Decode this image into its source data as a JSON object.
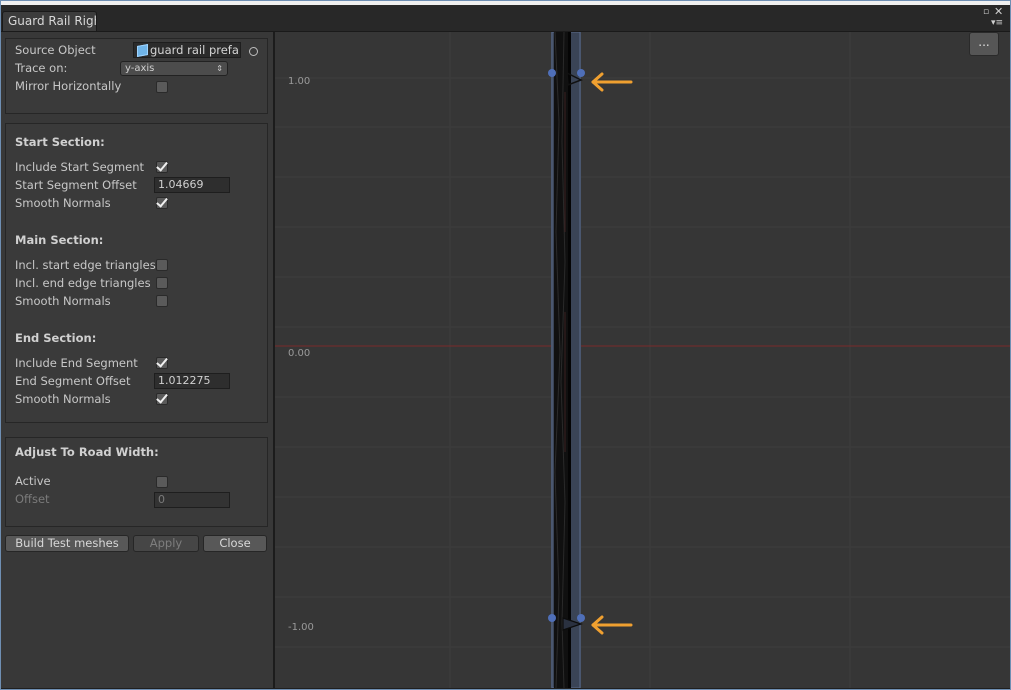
{
  "window": {
    "tab_title": "Guard Rail Righ"
  },
  "source_group": {
    "source_object_label": "Source Object",
    "source_object_value": "guard rail prefa",
    "trace_on_label": "Trace on:",
    "trace_on_value": "y-axis",
    "mirror_label": "Mirror Horizontally",
    "mirror_checked": false
  },
  "start_section": {
    "heading": "Start Section:",
    "include_label": "Include Start Segment",
    "include_checked": true,
    "offset_label": "Start Segment Offset",
    "offset_value": "1.04669",
    "smooth_label": "Smooth Normals",
    "smooth_checked": true
  },
  "main_section": {
    "heading": "Main Section:",
    "start_edge_label": "Incl. start edge triangles",
    "start_edge_checked": false,
    "end_edge_label": "Incl. end edge triangles",
    "end_edge_checked": false,
    "smooth_label": "Smooth Normals",
    "smooth_checked": false
  },
  "end_section": {
    "heading": "End Section:",
    "include_label": "Include End Segment",
    "include_checked": true,
    "offset_label": "End Segment Offset",
    "offset_value": "1.012275",
    "smooth_label": "Smooth Normals",
    "smooth_checked": true
  },
  "adjust_section": {
    "heading": "Adjust To Road Width:",
    "active_label": "Active",
    "active_checked": false,
    "offset_label": "Offset",
    "offset_value": "0"
  },
  "buttons": {
    "build": "Build Test meshes",
    "apply": "Apply",
    "close": "Close"
  },
  "viewport": {
    "more_label": "...",
    "y_labels": [
      "1.00",
      "0.00",
      "-1.00"
    ],
    "arrow_color": "#f0a030",
    "handle_color": "#4f6fb8",
    "axis_color": "#7a2a2a"
  }
}
